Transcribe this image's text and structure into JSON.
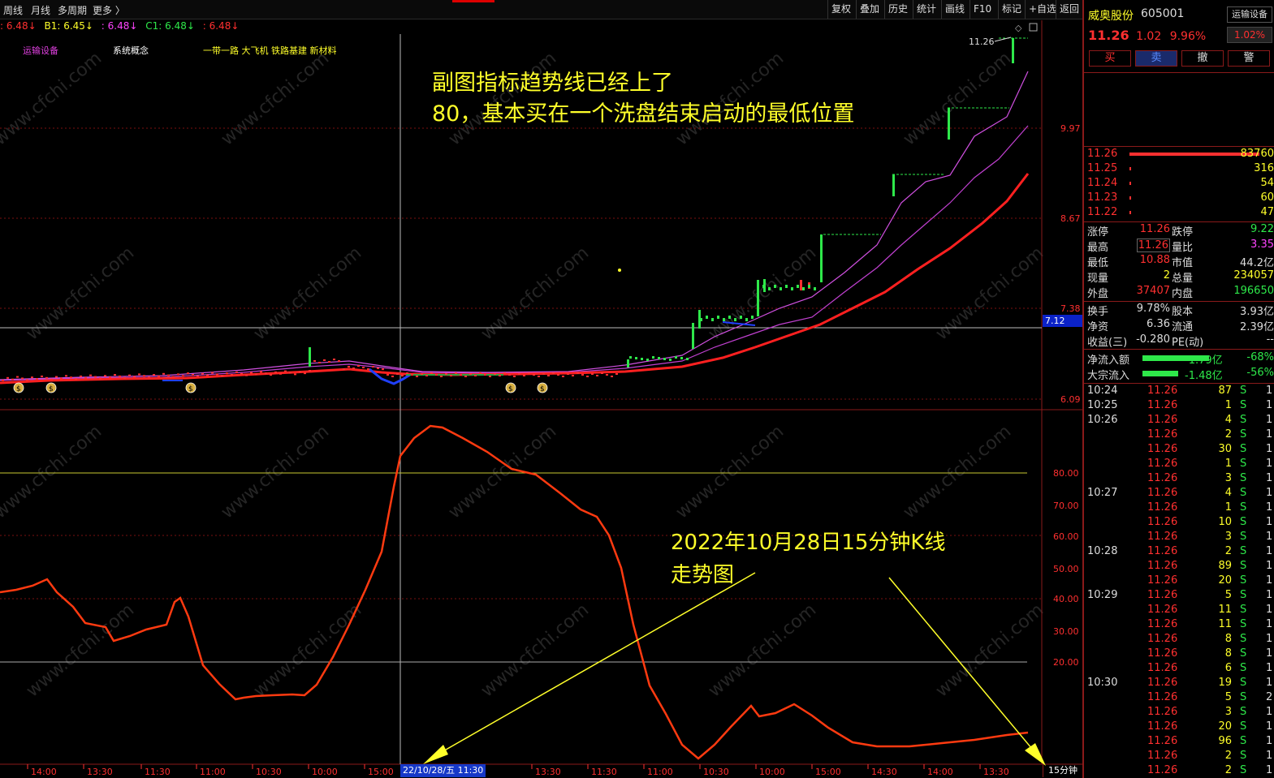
{
  "toolbar": {
    "left_tabs": [
      "周线",
      "月线",
      "多周期",
      "更多 〉"
    ],
    "right_buttons": [
      "复权",
      "叠加",
      "历史",
      "统计",
      "画线",
      "F10",
      "标记",
      "+自选",
      "返回"
    ]
  },
  "indicator_row": [
    {
      "text": ": 6.48↓",
      "color": "#ff3030"
    },
    {
      "text": "B1: 6.45↓",
      "color": "#ffff2a"
    },
    {
      "text": ": 6.48↓",
      "color": "#ff44ff"
    },
    {
      "text": "C1: 6.48↓",
      "color": "#2ee84a"
    },
    {
      "text": ": 6.48↓",
      "color": "#ff3030"
    }
  ],
  "concepts": [
    {
      "text": "运输设备",
      "color": "#e040e0"
    },
    {
      "text": "系统概念",
      "color": "#ffffff"
    },
    {
      "text": "一带一路 大飞机 铁路基建 新材料",
      "color": "#ffff2a"
    }
  ],
  "price_axis": [
    "9.97",
    "8.67",
    "7.38",
    "6.09"
  ],
  "current_price_label": "7.12",
  "top_marker": "11.26",
  "indicator_axis": [
    "80.00",
    "70.00",
    "60.00",
    "50.00",
    "40.00",
    "30.00",
    "20.00"
  ],
  "time_axis": [
    "14:00",
    "13:30",
    "11:30",
    "11:00",
    "10:30",
    "10:00",
    "15:00",
    "14:00",
    "13:30",
    "11:30",
    "11:00",
    "10:30",
    "10:00",
    "15:00",
    "14:30",
    "14:00",
    "13:30"
  ],
  "cursor_date": "22/10/28/五 11:30",
  "period_label": "15分钟",
  "annotations": {
    "top_line1": "副图指标趋势线已经上了",
    "top_line2": "80，基本买在一个洗盘结束启动的最低位置",
    "bottom_line1": "2022年10月28日15分钟K线",
    "bottom_line2": "走势图"
  },
  "watermark": "www.cfchi.com",
  "colors": {
    "up": "#ff3030",
    "down": "#2ee84a",
    "accent": "#ffff2a",
    "panel_border": "#8a1a1a"
  },
  "stock": {
    "name": "威奥股份",
    "code": "605001",
    "sector_button": "运输设备",
    "price": "11.26",
    "change": "1.02",
    "change_pct": "9.96%",
    "change_pct_box": "1.02%"
  },
  "trade_buttons": [
    "买",
    "卖",
    "撤",
    "警"
  ],
  "orderbook": [
    {
      "price": "11.26",
      "vol": "83760",
      "bar": 160
    },
    {
      "price": "11.25",
      "vol": "316",
      "bar": 2
    },
    {
      "price": "11.24",
      "vol": "54",
      "bar": 2
    },
    {
      "price": "11.23",
      "vol": "60",
      "bar": 2
    },
    {
      "price": "11.22",
      "vol": "47",
      "bar": 2
    }
  ],
  "stats": [
    {
      "l1": "涨停",
      "v1": "11.26",
      "c1": "#ff3030",
      "l2": "跌停",
      "v2": "9.22",
      "c2": "#2ee84a"
    },
    {
      "l1": "最高",
      "v1": "11.26",
      "c1": "#ff3030",
      "l2": "量比",
      "v2": "3.35",
      "c2": "#ff44ff"
    },
    {
      "l1": "最低",
      "v1": "10.88",
      "c1": "#ff3030",
      "l2": "市值",
      "v2": "44.2亿",
      "c2": "#ddd"
    },
    {
      "l1": "现量",
      "v1": "2",
      "c1": "#ffff2a",
      "l2": "总量",
      "v2": "234057",
      "c2": "#ffff2a"
    },
    {
      "l1": "外盘",
      "v1": "37407",
      "c1": "#ff3030",
      "l2": "内盘",
      "v2": "196650",
      "c2": "#2ee84a"
    }
  ],
  "stats2": [
    {
      "l1": "换手",
      "v1": "9.78%",
      "c1": "#ddd",
      "l2": "股本",
      "v2": "3.93亿",
      "c2": "#ddd"
    },
    {
      "l1": "净资",
      "v1": "6.36",
      "c1": "#ddd",
      "l2": "流通",
      "v2": "2.39亿",
      "c2": "#ddd"
    },
    {
      "l1": "收益(三)",
      "v1": "-0.280",
      "c1": "#ddd",
      "l2": "PE(动)",
      "v2": "--",
      "c2": "#ddd"
    }
  ],
  "flows": [
    {
      "label": "净流入额",
      "value": "-1.79亿",
      "pct": "-68%"
    },
    {
      "label": "大宗流入",
      "value": "-1.48亿",
      "pct": "-56%"
    }
  ],
  "ticks": [
    {
      "t": "10:24",
      "p": "11.26",
      "v": "87",
      "s": "S",
      "n": "1"
    },
    {
      "t": "10:25",
      "p": "11.26",
      "v": "1",
      "s": "S",
      "n": "1"
    },
    {
      "t": "10:26",
      "p": "11.26",
      "v": "4",
      "s": "S",
      "n": "1"
    },
    {
      "t": "",
      "p": "11.26",
      "v": "2",
      "s": "S",
      "n": "1"
    },
    {
      "t": "",
      "p": "11.26",
      "v": "30",
      "s": "S",
      "n": "1"
    },
    {
      "t": "",
      "p": "11.26",
      "v": "1",
      "s": "S",
      "n": "1"
    },
    {
      "t": "",
      "p": "11.26",
      "v": "3",
      "s": "S",
      "n": "1"
    },
    {
      "t": "10:27",
      "p": "11.26",
      "v": "4",
      "s": "S",
      "n": "1"
    },
    {
      "t": "",
      "p": "11.26",
      "v": "1",
      "s": "S",
      "n": "1"
    },
    {
      "t": "",
      "p": "11.26",
      "v": "10",
      "s": "S",
      "n": "1"
    },
    {
      "t": "",
      "p": "11.26",
      "v": "3",
      "s": "S",
      "n": "1"
    },
    {
      "t": "10:28",
      "p": "11.26",
      "v": "2",
      "s": "S",
      "n": "1"
    },
    {
      "t": "",
      "p": "11.26",
      "v": "89",
      "s": "S",
      "n": "1"
    },
    {
      "t": "",
      "p": "11.26",
      "v": "20",
      "s": "S",
      "n": "1"
    },
    {
      "t": "10:29",
      "p": "11.26",
      "v": "5",
      "s": "S",
      "n": "1"
    },
    {
      "t": "",
      "p": "11.26",
      "v": "11",
      "s": "S",
      "n": "1"
    },
    {
      "t": "",
      "p": "11.26",
      "v": "11",
      "s": "S",
      "n": "1"
    },
    {
      "t": "",
      "p": "11.26",
      "v": "8",
      "s": "S",
      "n": "1"
    },
    {
      "t": "",
      "p": "11.26",
      "v": "8",
      "s": "S",
      "n": "1"
    },
    {
      "t": "",
      "p": "11.26",
      "v": "6",
      "s": "S",
      "n": "1"
    },
    {
      "t": "10:30",
      "p": "11.26",
      "v": "19",
      "s": "S",
      "n": "1"
    },
    {
      "t": "",
      "p": "11.26",
      "v": "5",
      "s": "S",
      "n": "2"
    },
    {
      "t": "",
      "p": "11.26",
      "v": "3",
      "s": "S",
      "n": "1"
    },
    {
      "t": "",
      "p": "11.26",
      "v": "20",
      "s": "S",
      "n": "1"
    },
    {
      "t": "",
      "p": "11.26",
      "v": "96",
      "s": "S",
      "n": "1"
    },
    {
      "t": "",
      "p": "11.26",
      "v": "2",
      "s": "S",
      "n": "1"
    },
    {
      "t": "",
      "p": "11.26",
      "v": "2",
      "s": "S",
      "n": "1"
    }
  ]
}
